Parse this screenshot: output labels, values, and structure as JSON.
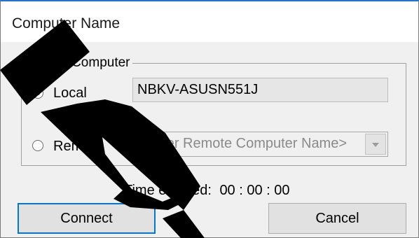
{
  "window": {
    "title": "Computer Name"
  },
  "select_group": {
    "legend": "Select Computer",
    "local": {
      "label": "Local",
      "checked": true,
      "computer_name": "NBKV-ASUSN551J"
    },
    "remote": {
      "label": "Remote",
      "checked": false,
      "placeholder": "<Enter Remote Computer Name>"
    }
  },
  "status": {
    "time_label": "Time elapsed:",
    "time_value": "00 : 00 : 00"
  },
  "buttons": {
    "connect": "Connect",
    "cancel": "Cancel"
  },
  "icons": {
    "dropdown": "chevron-down-icon",
    "watermark": "watermark-logo"
  },
  "colors": {
    "title_accent": "#1e73d9",
    "watermark": "#000000"
  }
}
